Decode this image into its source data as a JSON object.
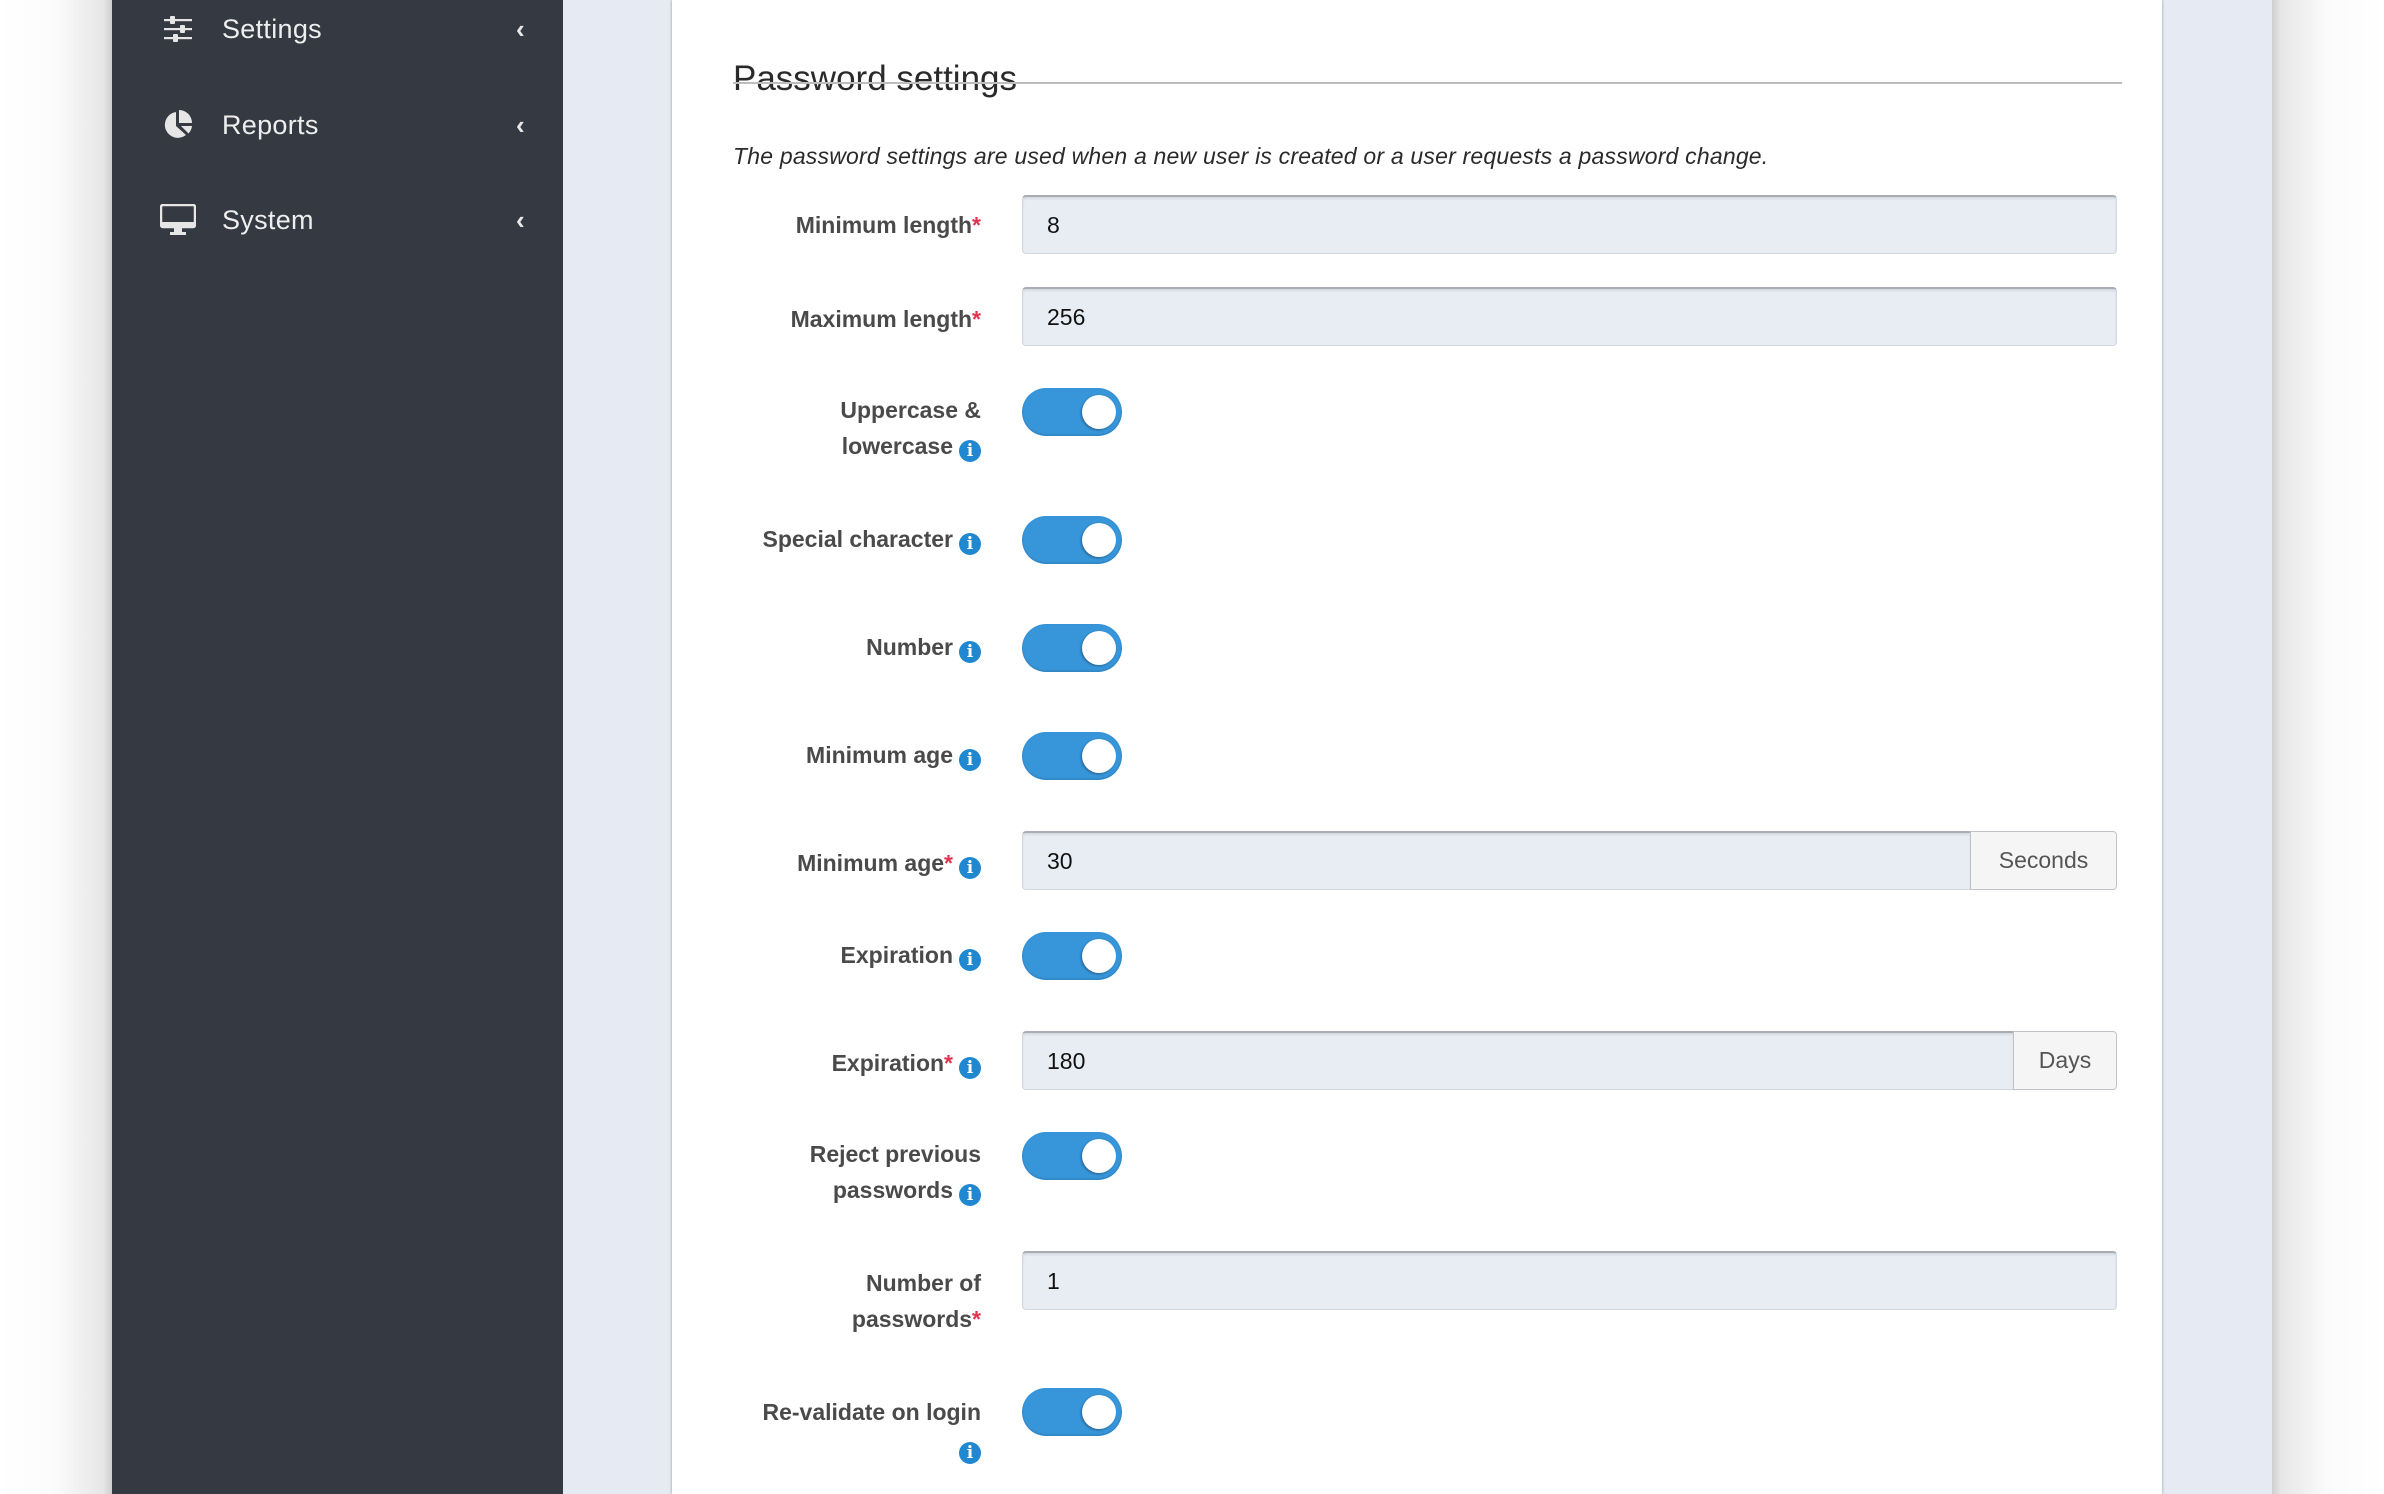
{
  "sidebar": {
    "items": [
      {
        "label": "Settings",
        "icon": "sliders-icon"
      },
      {
        "label": "Reports",
        "icon": "pie-chart-icon"
      },
      {
        "label": "System",
        "icon": "desktop-icon"
      }
    ],
    "chevron": "‹"
  },
  "section": {
    "title": "Password settings",
    "description": "The password settings are used when a new user is created or a user requests a password change."
  },
  "colors": {
    "accent": "#3795d9",
    "required": "#e0344e",
    "info": "#1f88d0",
    "sidebar_bg": "#353a42"
  },
  "form": {
    "required_mark": "*",
    "info_glyph": "i",
    "min_length": {
      "label": "Minimum length",
      "value": "8"
    },
    "max_length": {
      "label": "Maximum length",
      "value": "256"
    },
    "upper_lower": {
      "label_line1": "Uppercase &",
      "label_line2": "lowercase",
      "enabled": true
    },
    "special_char": {
      "label": "Special character",
      "enabled": true
    },
    "number": {
      "label": "Number",
      "enabled": true
    },
    "min_age_toggle": {
      "label": "Minimum age",
      "enabled": true
    },
    "min_age_value": {
      "label": "Minimum age",
      "value": "30",
      "unit": "Seconds"
    },
    "expiration_toggle": {
      "label": "Expiration",
      "enabled": true
    },
    "expiration_value": {
      "label": "Expiration",
      "value": "180",
      "unit": "Days"
    },
    "reject_previous": {
      "label_line1": "Reject previous",
      "label_line2": "passwords",
      "enabled": true
    },
    "number_of_passwords": {
      "label_line1": "Number of",
      "label_line2": "passwords",
      "value": "1"
    },
    "revalidate": {
      "label": "Re-validate on login",
      "enabled": true
    }
  }
}
